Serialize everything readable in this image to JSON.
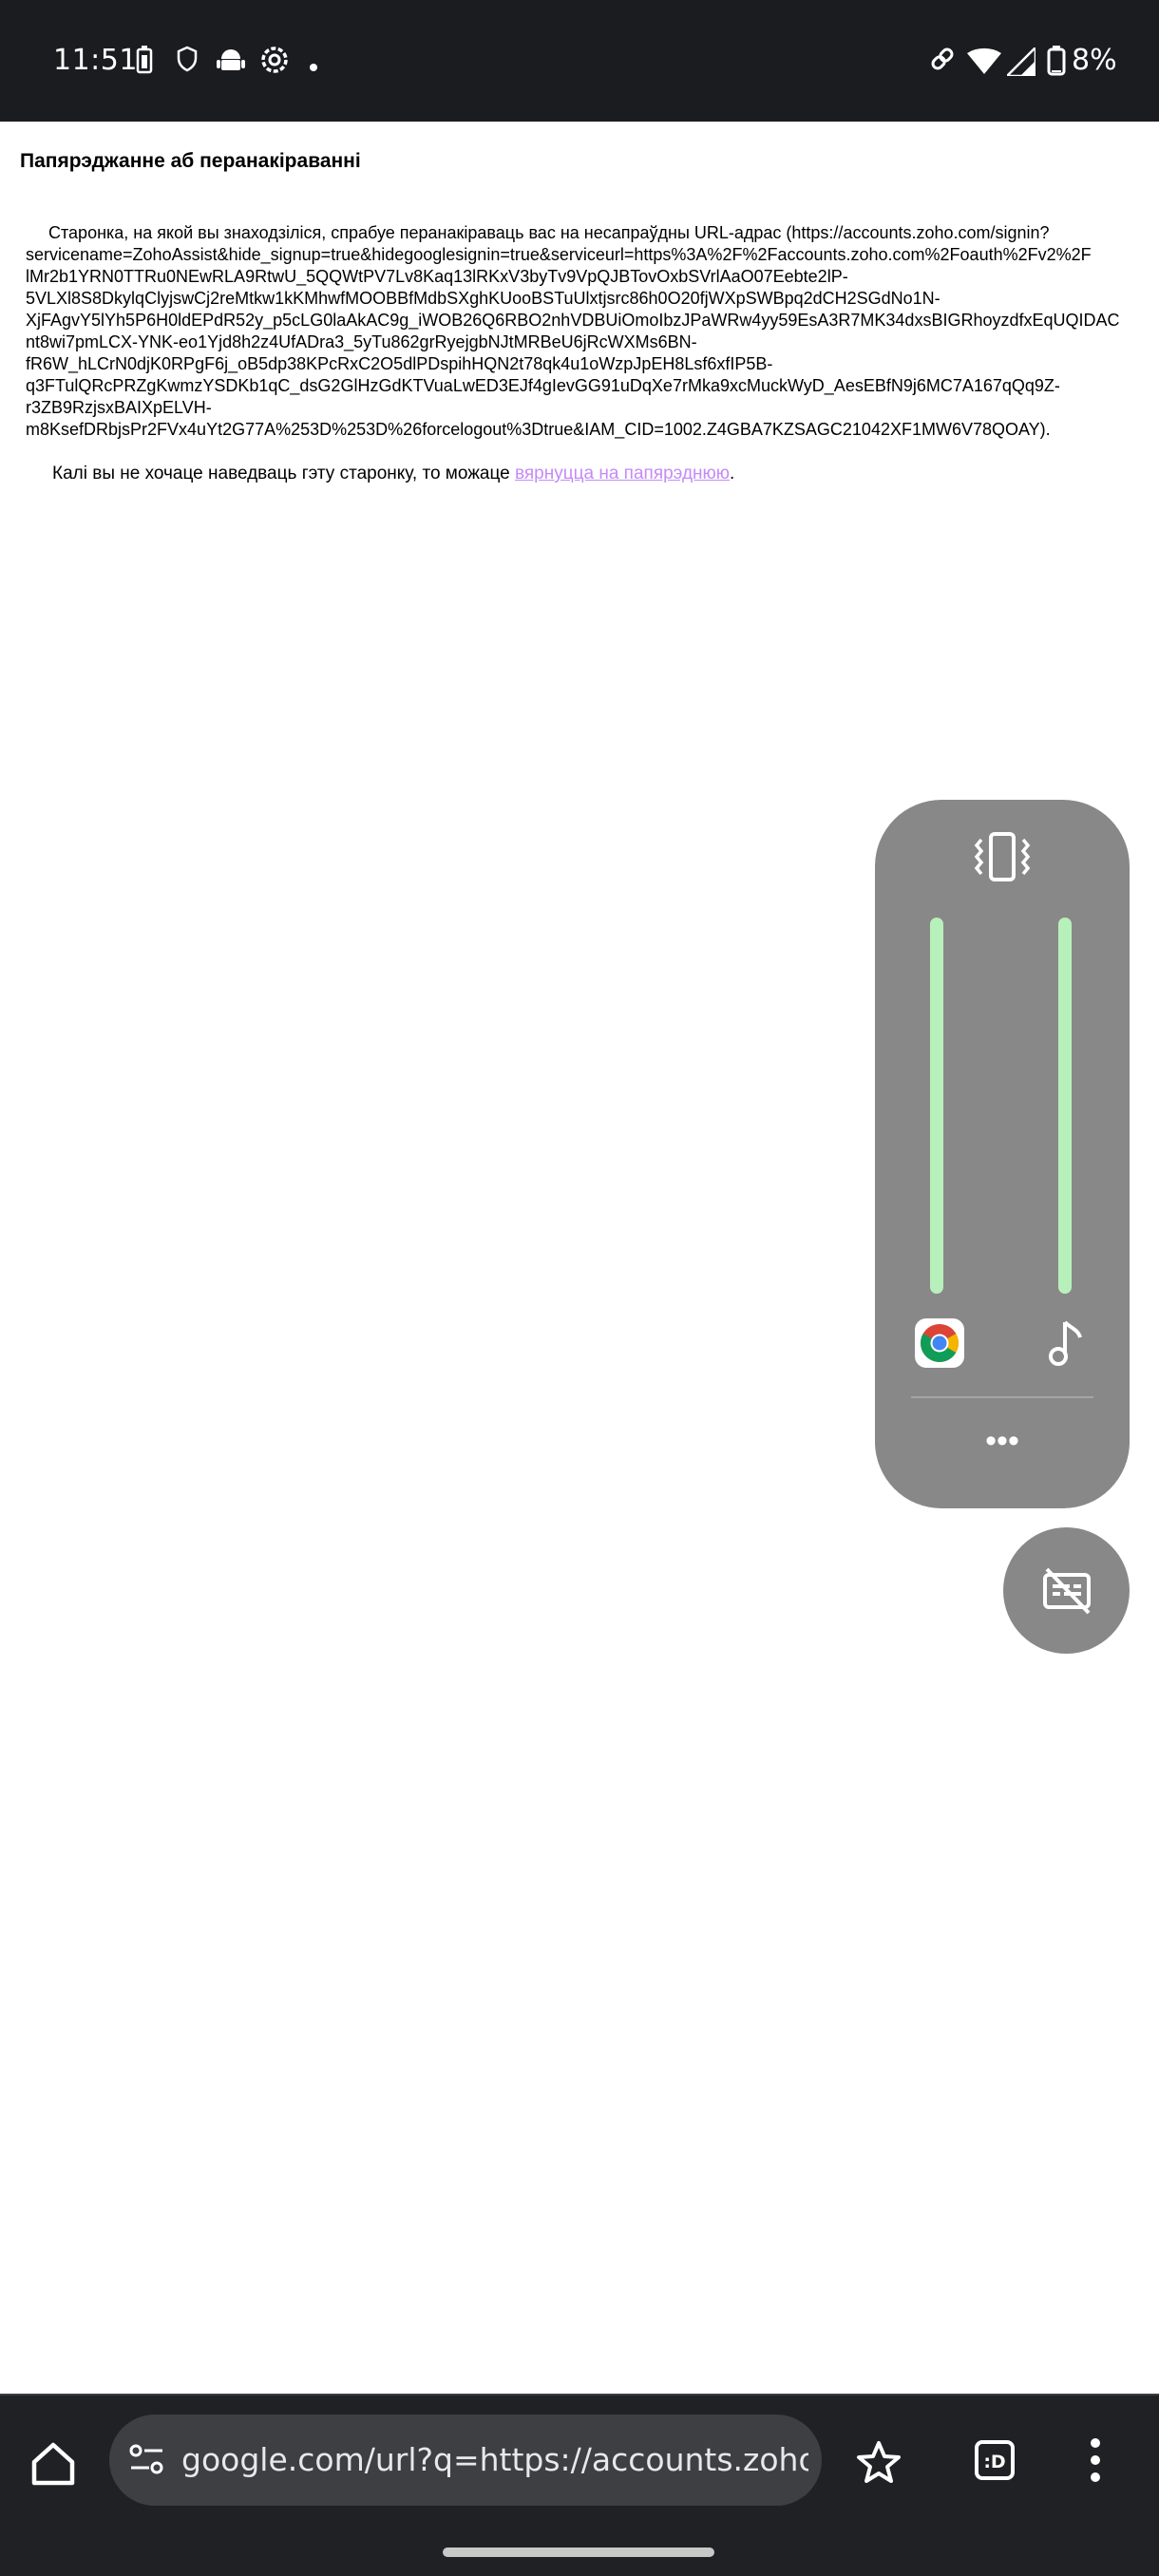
{
  "status_bar": {
    "time": "11:51",
    "battery_percent": "8%",
    "left_icons": [
      "battery-saver-icon",
      "shield-icon",
      "android-icon",
      "settings-icon",
      "notification-dot-icon"
    ],
    "right_icons": [
      "link-icon",
      "wifi-icon",
      "signal-icon",
      "battery-icon"
    ]
  },
  "page": {
    "heading": "Папярэджанне аб перанакіраванні",
    "redirect_lines": [
      " Старонка, на якой вы знаходзіліся, спрабуе перанакіраваць вас на несапраўдны URL-адрас (https://accounts.zoho.com/signin?",
      "servicename=ZohoAssist&hide_signup=true&hidegooglesignin=true&serviceurl=https%3A%2F%2Faccounts.zoho.com%2Foauth%2Fv2%2F",
      "lMr2b1YRN0TTRu0NEwRLA9RtwU_5QQWtPV7Lv8Kaq13lRKxV3byTv9VpQJBTovOxbSVrlAaO07Eebte2lP-",
      "5VLXl8S8DkylqClyjswCj2reMtkw1kKMhwfMOOBBfMdbSXghKUooBSTuUlxtjsrc86h0O20fjWXpSWBpq2dCH2SGdNo1N-",
      "XjFAgvY5lYh5P6H0ldEPdR52y_p5cLG0laAkAC9g_iWOB26Q6RBO2nhVDBUiOmoIbzJPaWRw4yy59EsA3R7MK34dxsBIGRhoyzdfxEqUQIDAC",
      "nt8wi7pmLCX-YNK-eo1Yjd8h2z4UfADra3_5yTu862grRyejgbNJtMRBeU6jRcWXMs6BN-",
      "fR6W_hLCrN0djK0RPgF6j_oB5dp38KPcRxC2O5dlPDspihHQN2t78qk4u1oWzpJpEH8Lsf6xfIP5B-",
      "q3FTulQRcPRZgKwmzYSDKb1qC_dsG2GlHzGdKTVuaLwED3EJf4gIevGG91uDqXe7rMka9xcMuckWyD_AesEBfN9j6MC7A167qQq9Z-",
      "r3ZB9RzjsxBAIXpELVH-",
      "m8KsefDRbjsPr2FVx4uYt2G77A%253D%253D%26forcelogout%3Dtrue&IAM_CID=1002.Z4GBA7KZSAGC21042XF1MW6V78QOAY)."
    ],
    "back_prefix": " Калі вы не хочаце наведваць гэту старонку, то можаце ",
    "back_link": "вярнуцца на папярэднюю",
    "back_suffix": "."
  },
  "volume_panel": {
    "ring_mode_icon": "vibrate-icon",
    "sliders": [
      {
        "name": "app",
        "icon": "chrome-icon",
        "level": 1.0
      },
      {
        "name": "media",
        "icon": "music-note-icon",
        "level": 1.0
      }
    ],
    "more_label": "•••"
  },
  "live_caption": {
    "icon": "live-caption-off-icon"
  },
  "browser_toolbar": {
    "url": "google.com/url?q=https://accounts.zoho.com",
    "icons": [
      "home-icon",
      "site-settings-icon",
      "bookmark-star-icon",
      "tab-switcher-icon",
      "more-vert-icon"
    ],
    "colors": {
      "toolbar": "#202125",
      "url_pill": "#3d3f43",
      "link": "#c58af9",
      "slider": "#b8f0bb"
    }
  }
}
